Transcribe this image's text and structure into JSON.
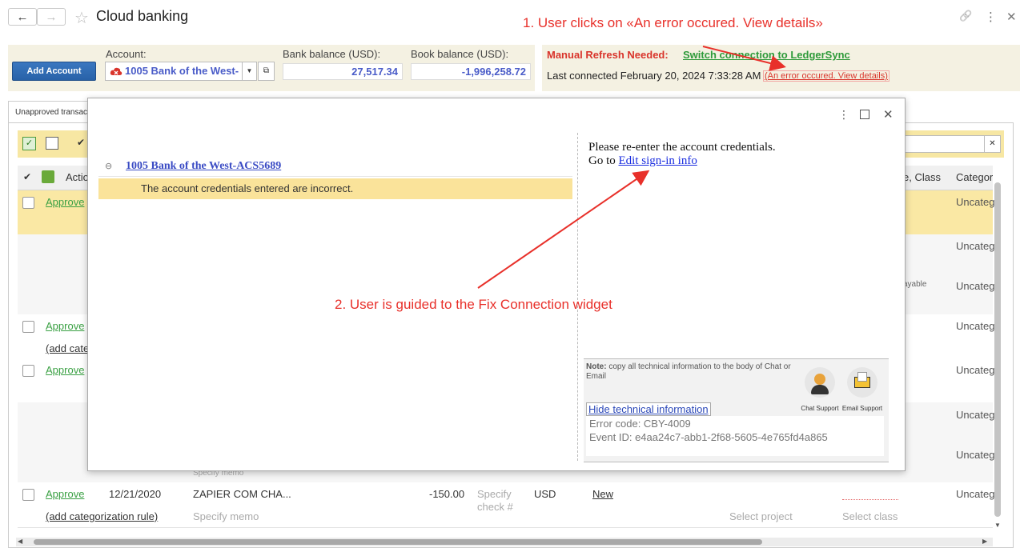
{
  "window": {
    "title": "Cloud banking",
    "back_icon": "←",
    "forward_icon": "→",
    "star_icon": "☆",
    "link_icon": "🔗",
    "more_icon": "⋮",
    "close_icon": "✕"
  },
  "annotations": {
    "step1": "1. User clicks on «An error occured. View details»",
    "step2": "2. User is guided to the Fix Connection widget",
    "color": "#e8302a"
  },
  "header": {
    "add_account": "Add Account",
    "account_label": "Account:",
    "account_value": "1005 Bank of the West-",
    "bank_balance_label": "Bank balance (USD):",
    "bank_balance": "27,517.34",
    "book_balance_label": "Book balance (USD):",
    "book_balance": "-1,996,258.72",
    "refresh_needed": "Manual Refresh Needed:",
    "switch_link": "Switch connection to LedgerSync",
    "last_connected": "Last connected February 20, 2024 7:33:28 AM",
    "error_link": "(An error occured. View details)"
  },
  "table": {
    "tab_label": "Unapproved transactions",
    "col_action": "Actio",
    "col_class": "e, Class",
    "col_category": "Categor",
    "approve": "Approve",
    "uncat": "Uncateg",
    "add_rule_short": "(add cate",
    "add_rule": "(add categorization rule)",
    "payable": "ayable",
    "specify_memo": "Specify memo",
    "last_row": {
      "date": "12/21/2020",
      "payee": "ZAPIER COM CHA...",
      "amount": "-150.00",
      "check": "Specify check #",
      "currency": "USD",
      "status": "New",
      "project": "Select project",
      "class": "Select class"
    }
  },
  "modal": {
    "account_link": "1005 Bank of the West-ACS5689",
    "error_message": "The account credentials entered are incorrect.",
    "reenter": "Please re-enter the account credentials.",
    "go_to": "Go to",
    "edit_link": "Edit sign-in info",
    "note_label": "Note:",
    "note_text": "copy all technical information to the body of Chat or Email",
    "chat_support": "Chat Support",
    "email_support": "Email Support",
    "hide_tech": "Hide technical information",
    "error_code": "Error code: CBY-4009",
    "event_id": "Event ID: e4aa24c7-abb1-2f68-5605-4e765fd4a865"
  }
}
